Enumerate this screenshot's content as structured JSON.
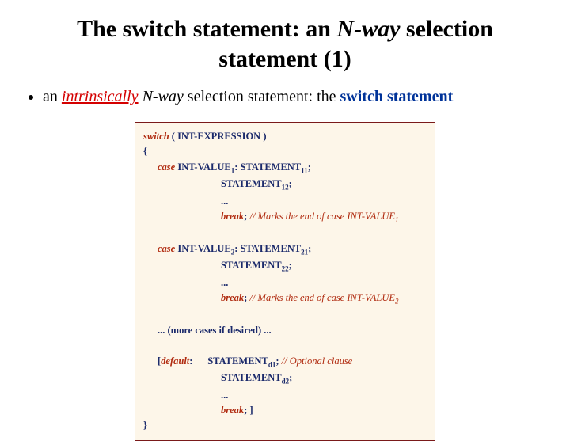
{
  "title_a": "The switch statement: an ",
  "title_b": "N-way",
  "title_c": " selection statement (1)",
  "bullet_a": "an ",
  "bullet_intr": "intrinsically",
  "bullet_nway": " N-way",
  "bullet_mid": " selection statement: the ",
  "bullet_kw": "switch statement",
  "code": {
    "l1_kw": "switch",
    "l1_rest": " ( INT-EXPRESSION )",
    "lbrace": "{",
    "case_kw": "case",
    "c1_label": " INT-VALUE",
    "c1_sub": "1",
    "c1_stmt11": "STATEMENT",
    "s11_sub": "11",
    "c1_stmt12": "STATEMENT",
    "s12_sub": "12",
    "dots": "...",
    "break_kw": "break",
    "semi": ";",
    "cmt_mark1": "  // Marks the end of case INT-VALUE",
    "c2_label": " INT-VALUE",
    "c2_sub": "2",
    "c2_stmt21": "STATEMENT",
    "s21_sub": "21",
    "c2_stmt22": "STATEMENT",
    "s22_sub": "22",
    "cmt_mark2": "  // Marks the end of case INT-VALUE",
    "more": "... (more cases if desired) ...",
    "def_lb": "[",
    "def_kw": "default",
    "def_colon": ":",
    "d_stmt1": "STATEMENT",
    "d1_sub": "d1",
    "cmt_opt": "  // Optional clause",
    "d_stmt2": "STATEMENT",
    "d2_sub": "d2",
    "def_rb": " ]",
    "rbrace": "}"
  }
}
